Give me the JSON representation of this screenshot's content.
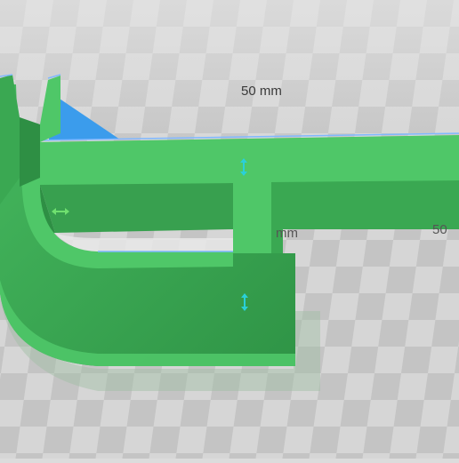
{
  "viewport": {
    "background": "#dcdcdc",
    "bed_light": "#d3d3d3",
    "bed_dark": "#bdbdbd"
  },
  "model": {
    "color_top": "#4fc768",
    "color_side": "#3aa852",
    "color_dark": "#2e8f44",
    "support_color": "#3b9cec",
    "edge_highlight": "#7fb8ff"
  },
  "dimensions": {
    "top_label": "50 mm",
    "right_label_fragment": "50",
    "mid_label_fragment": "mm"
  },
  "handles": {
    "horizontal_left_icon": "horizontal-resize-arrow-icon",
    "vertical_top_icon": "vertical-resize-arrow-icon",
    "vertical_bottom_icon": "vertical-resize-arrow-icon",
    "accent_light": "#6fe06f",
    "accent_cyan": "#2ad0d8"
  }
}
